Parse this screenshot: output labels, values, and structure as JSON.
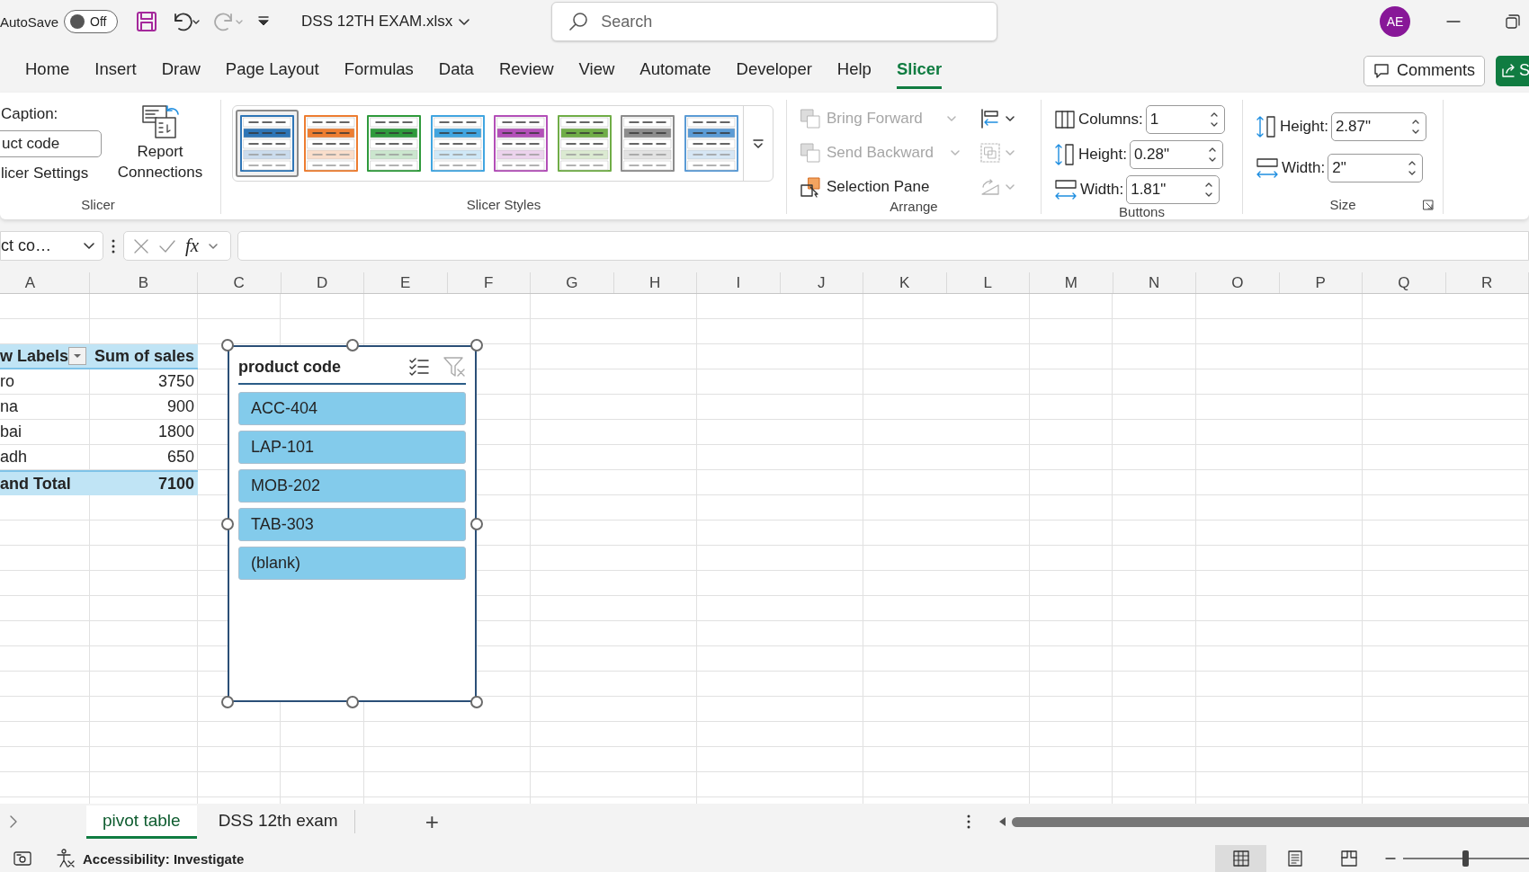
{
  "title_bar": {
    "autosave_label": "AutoSave",
    "autosave_toggle": {
      "label": "Off",
      "on": false
    },
    "file_name": "DSS 12TH EXAM.xlsx",
    "search": {
      "placeholder": "Search"
    },
    "avatar": "AE"
  },
  "ribbon_tabs": [
    {
      "label": "Home",
      "selected": false
    },
    {
      "label": "Insert",
      "selected": false
    },
    {
      "label": "Draw",
      "selected": false
    },
    {
      "label": "Page Layout",
      "selected": false
    },
    {
      "label": "Formulas",
      "selected": false
    },
    {
      "label": "Data",
      "selected": false
    },
    {
      "label": "Review",
      "selected": false
    },
    {
      "label": "View",
      "selected": false
    },
    {
      "label": "Automate",
      "selected": false
    },
    {
      "label": "Developer",
      "selected": false
    },
    {
      "label": "Help",
      "selected": false
    },
    {
      "label": "Slicer",
      "selected": true
    }
  ],
  "comments_button": "Comments",
  "share_button": "S",
  "slicer_group": {
    "caption_label": "Caption:",
    "caption_value": "uct code",
    "settings_button": "licer Settings",
    "report_button": "Report Connections",
    "label": "Slicer"
  },
  "slicer_styles": {
    "label": "Slicer Styles",
    "styles": [
      {
        "color": "#2e75b6",
        "selected": true
      },
      {
        "color": "#ed7d31",
        "selected": false
      },
      {
        "color": "#2f9a3c",
        "selected": false
      },
      {
        "color": "#41a5e0",
        "selected": false
      },
      {
        "color": "#b34fb8",
        "selected": false
      },
      {
        "color": "#70ad47",
        "selected": false
      },
      {
        "color": "#8c8c8c",
        "selected": false
      },
      {
        "color": "#5b9bd5",
        "selected": false
      }
    ]
  },
  "arrange_group": {
    "label": "Arrange",
    "commands": [
      {
        "kind": "bring_forward",
        "label": "Bring Forward",
        "disabled": true
      },
      {
        "kind": "send_backward",
        "label": "Send Backward",
        "disabled": true
      },
      {
        "kind": "selection_pane",
        "label": "Selection Pane",
        "disabled": false
      }
    ],
    "tools": [
      {
        "kind": "align",
        "disabled": false
      },
      {
        "kind": "group",
        "disabled": true
      },
      {
        "kind": "rotate",
        "disabled": true
      }
    ]
  },
  "buttons_group": {
    "label": "Buttons",
    "fields": [
      {
        "kind": "columns",
        "label": "Columns:",
        "value": "1"
      },
      {
        "kind": "height",
        "label": "Height:",
        "value": "0.28\""
      },
      {
        "kind": "width",
        "label": "Width:",
        "value": "1.81\""
      }
    ]
  },
  "size_group": {
    "label": "Size",
    "fields": [
      {
        "kind": "height",
        "label": "Height:",
        "value": "2.87\""
      },
      {
        "kind": "width",
        "label": "Width:",
        "value": "2\""
      }
    ]
  },
  "formula_bar": {
    "name_box": "ct co…",
    "function_label": "fx"
  },
  "columns": [
    "A",
    "B",
    "C",
    "D",
    "E",
    "F",
    "G",
    "H",
    "I",
    "J",
    "K",
    "L",
    "M",
    "N",
    "O",
    "P",
    "Q",
    "R"
  ],
  "pivot_table": {
    "headers": [
      "w Labels",
      "Sum of sales"
    ],
    "rows": [
      {
        "label": "ro",
        "value": "3750"
      },
      {
        "label": "na",
        "value": "900"
      },
      {
        "label": "bai",
        "value": "1800"
      },
      {
        "label": "adh",
        "value": "650"
      }
    ],
    "total": {
      "label": "and Total",
      "value": "7100"
    }
  },
  "slicer": {
    "title": "product code",
    "items": [
      {
        "label": "ACC-404",
        "selected": true
      },
      {
        "label": "LAP-101",
        "selected": true
      },
      {
        "label": "MOB-202",
        "selected": true
      },
      {
        "label": "TAB-303",
        "selected": true
      },
      {
        "label": "(blank)",
        "selected": true
      }
    ]
  },
  "sheet_tabs": [
    {
      "label": "pivot table",
      "selected": true
    },
    {
      "label": "DSS 12th exam",
      "selected": false
    }
  ],
  "add_sheet": "+",
  "status_bar": {
    "accessibility": "Accessibility: Investigate",
    "views": [
      {
        "kind": "normal",
        "selected": true
      },
      {
        "kind": "page_layout",
        "selected": false
      },
      {
        "kind": "page_break",
        "selected": false
      }
    ],
    "zoom_slider": {
      "level": 0.5
    }
  }
}
